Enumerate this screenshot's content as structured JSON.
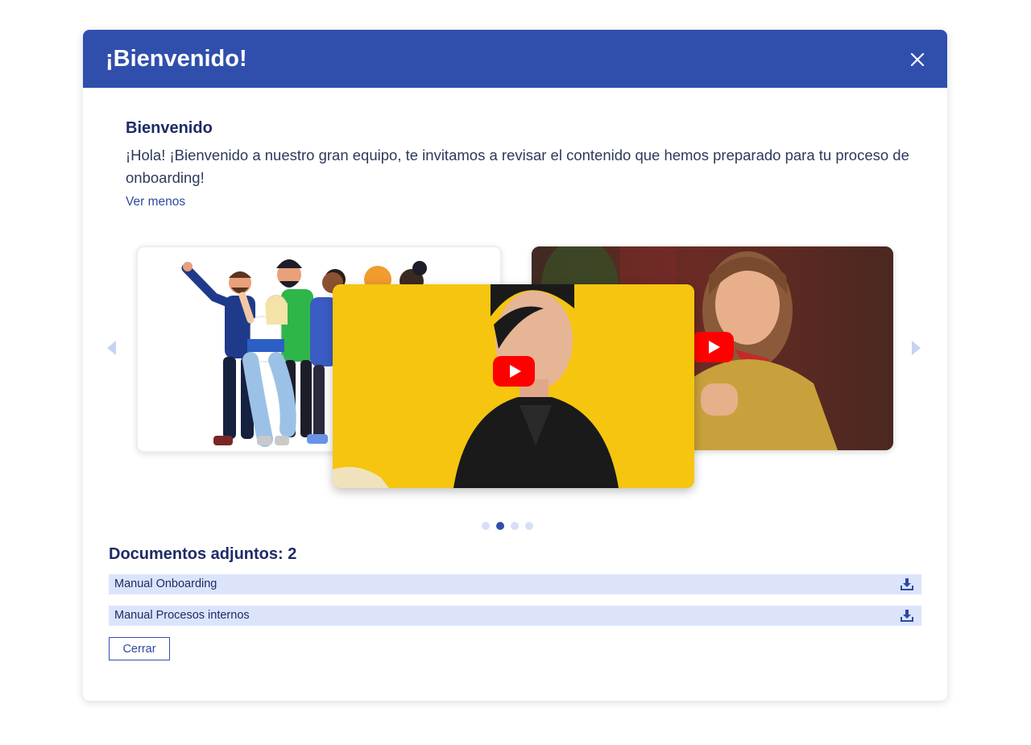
{
  "modal": {
    "title": "¡Bienvenido!",
    "close_icon": "close-icon",
    "header_color": "#304fad"
  },
  "intro": {
    "heading": "Bienvenido",
    "text": "¡Hola! ¡Bienvenido a nuestro gran equipo, te invitamos a revisar el contenido que hemos preparado para tu proceso de onboarding!",
    "toggle_link": "Ver menos"
  },
  "carousel": {
    "prev_icon": "chevron-left-icon",
    "next_icon": "chevron-right-icon",
    "slides": [
      {
        "type": "image",
        "subject": "team-illustration"
      },
      {
        "type": "video",
        "subject": "woman-yellow-background",
        "play_icon": "youtube-play-icon"
      },
      {
        "type": "video",
        "subject": "woman-mustard-shirt",
        "play_icon": "youtube-play-icon"
      }
    ],
    "page_count": 4,
    "active_page": 2
  },
  "attachments": {
    "title": "Documentos adjuntos: 2",
    "items": [
      {
        "name": "Manual Onboarding",
        "icon": "download-icon"
      },
      {
        "name": "Manual Procesos internos",
        "icon": "download-icon"
      }
    ]
  },
  "footer": {
    "close_button": "Cerrar"
  },
  "colors": {
    "primary": "#304fad",
    "heading": "#1e2b66",
    "attachment_row": "#dbe4fb",
    "youtube_red": "#ff0000"
  }
}
